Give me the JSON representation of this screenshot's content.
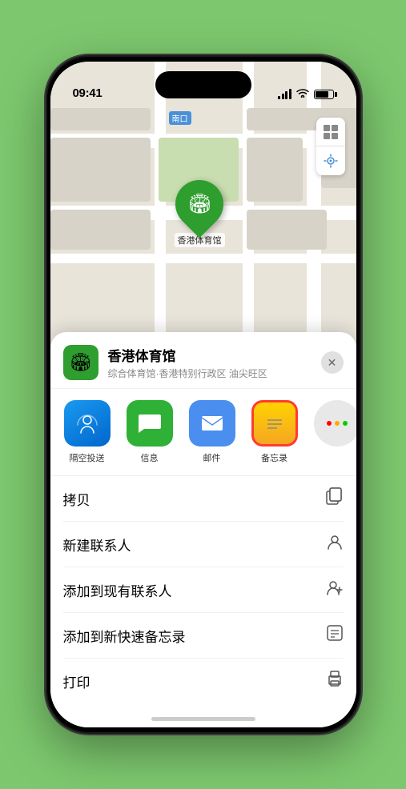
{
  "status": {
    "time": "09:41",
    "location_arrow": "▲"
  },
  "map": {
    "label_nk": "南口",
    "venue_name_pin": "香港体育馆",
    "controls": {
      "map_icon": "🗺",
      "location_icon": "➤"
    }
  },
  "sheet": {
    "venue_icon": "🏟",
    "venue_name": "香港体育馆",
    "venue_sub": "综合体育馆·香港特别行政区 油尖旺区",
    "close_label": "✕",
    "share_items": [
      {
        "id": "airdrop",
        "icon": "📡",
        "label": "隔空投送"
      },
      {
        "id": "messages",
        "icon": "💬",
        "label": "信息"
      },
      {
        "id": "mail",
        "icon": "✉",
        "label": "邮件"
      },
      {
        "id": "notes",
        "icon": "📋",
        "label": "备忘录",
        "selected": true
      },
      {
        "id": "more",
        "icon": "···",
        "label": ""
      }
    ],
    "actions": [
      {
        "label": "拷贝",
        "icon": "⧉"
      },
      {
        "label": "新建联系人",
        "icon": "👤"
      },
      {
        "label": "添加到现有联系人",
        "icon": "👤+"
      },
      {
        "label": "添加到新快速备忘录",
        "icon": "⊡"
      },
      {
        "label": "打印",
        "icon": "🖨"
      }
    ]
  }
}
